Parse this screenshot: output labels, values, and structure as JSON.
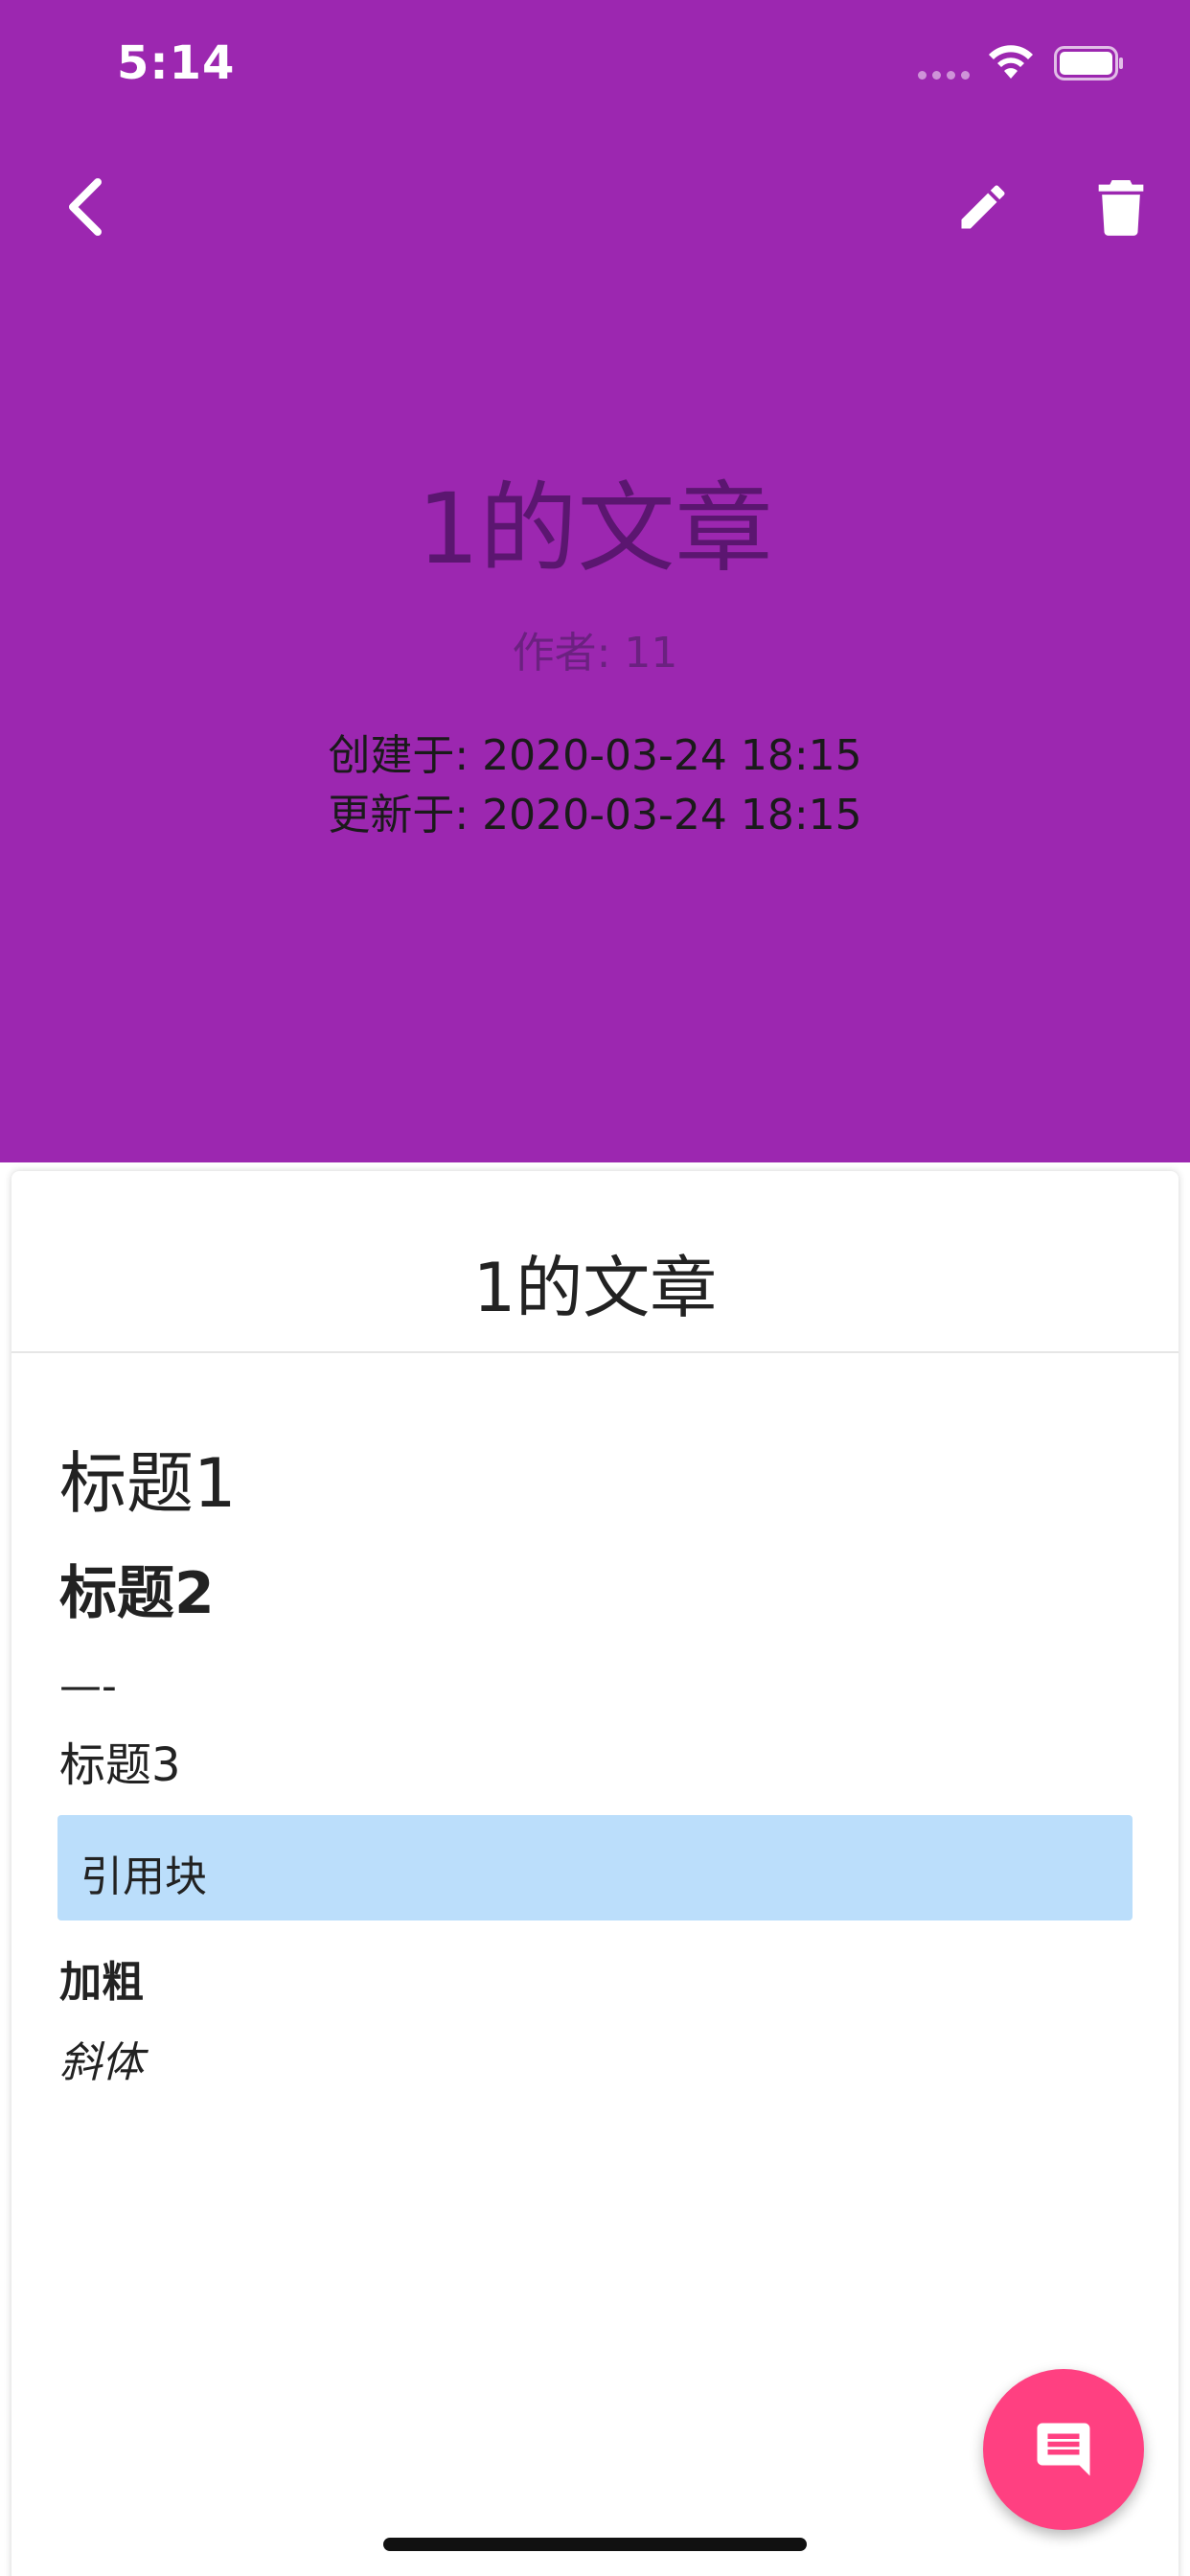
{
  "status_bar": {
    "time": "5:14"
  },
  "header": {
    "background_color": "#9c27b0",
    "back_icon": "chevron-left-icon",
    "edit_icon": "pencil-icon",
    "delete_icon": "trash-icon",
    "title": "1的文章",
    "author": "作者: 11",
    "created": "创建于: 2020-03-24 18:15",
    "updated": "更新于: 2020-03-24 18:15"
  },
  "article": {
    "title": "1的文章",
    "h1": "标题1",
    "h2": "标题2",
    "hr": "—-",
    "h3": "标题3",
    "blockquote": "引用块",
    "bold": "加粗",
    "italic": "斜体",
    "blockquote_color": "#bbdefb"
  },
  "fab": {
    "icon": "comment-icon",
    "color": "#ff4081"
  }
}
